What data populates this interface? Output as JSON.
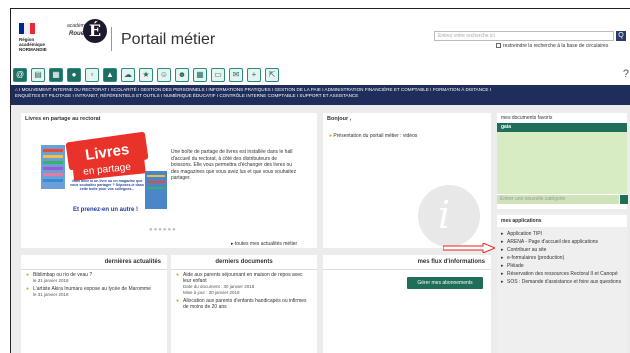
{
  "header": {
    "region": "Région académique NORMANDIE",
    "academy_small": "académie",
    "academy_name": "Rouen",
    "academy_letter": "É",
    "title": "Portail métier",
    "search_placeholder": "Entrez votre recherche ici",
    "search_button": "Q",
    "restrict_label": "restreindre la recherche à la base de circulaires"
  },
  "iconbar": {
    "icons": [
      "at-icon",
      "form-icon",
      "table-icon",
      "person-icon",
      "book-icon",
      "building-icon",
      "cloud-icon",
      "org-icon",
      "people-icon",
      "group-icon",
      "grid-icon",
      "screen-icon",
      "mail-icon",
      "plus-icon",
      "share-icon"
    ],
    "right": "?"
  },
  "nav": {
    "line1": "⌂ I  MOUVEMENT INTERNE DU RECTORAT  I  SCOLARITÉ  I  GESTION DES PERSONNELS  I  INFORMATIONS PRATIQUES  I  GESTION DE LA PAIE  I  ADMINISTRATION FINANCIÈRE ET COMPTABLE  I  FORMATION À DISTANCE  I",
    "line2": "ENQUÊTES ET PILOTAGE  I  INTRANET, RÉFÉRENTIELS ET OUTILS  I  NUMÉRIQUE ÉDUCATIF  I  CONTRÔLE INTERNE COMPTABLE  I  SUPPORT ET ASSISTANCE"
  },
  "news": {
    "heading": "Livres en partage au rectorat",
    "poster_title_1": "Livres",
    "poster_title_2": "en partage",
    "poster_text": "Vous avez lu un livre ou un magazine que vous souhaitez partager ? Déposez-le dans cette boîte pour vos collègues...",
    "poster_cta": "Et prenez-en un autre !",
    "body": "Une boîte de partage de livres est installée dans le hall d'accueil du rectorat, à côté des distributeurs de boissons. Elle vous permettra d'échanger des livres ou des magazines que vous avez lus et que vous souhaitez partager.",
    "dots": "●●●●●●",
    "more_link": "▸ toutes mes actualités métier"
  },
  "bonjour": {
    "heading": "Bonjour ,",
    "item": "Présentation du portail métier : vidéos",
    "info_glyph": "i"
  },
  "favorites": {
    "heading": "mes documents favoris",
    "bar": "gaia",
    "category_placeholder": "Entrer une nouvelle catégorie"
  },
  "apps": {
    "heading": "mes applications",
    "items": [
      "Application TIPI",
      "ARENA - Page d'accueil des applications",
      "Contribuer au site",
      "e-formulaires (production)",
      "Pléiade",
      "Réservation des ressources Rectoral II et Canopé",
      "SOS : Demande d'assistance et foire aux questions"
    ]
  },
  "actualites": {
    "heading": "dernières actualités",
    "items": [
      {
        "title": "Biblimbap ou rio de veau ?",
        "date": "le 31 janvier 2018"
      },
      {
        "title": "L'artiste Akira Inumaru expose au lycée de Maromme",
        "date": "le 31 janvier 2018"
      }
    ]
  },
  "documents": {
    "heading": "derniers documents",
    "items": [
      {
        "title": "Aide aux parents séjournant en maison de repos avec leur enfant",
        "date1": "Date du document : 30 janvier 2018",
        "date2": "Mise à jour : 30 janvier 2018"
      },
      {
        "title": "Allocation aux parents d'enfants handicapés ou infirmes de moins de 20 ans",
        "date1": "",
        "date2": ""
      }
    ]
  },
  "flux": {
    "heading": "mes flux d'informations",
    "button": "Gérer mes abonnements"
  },
  "colors": {
    "nav": "#1e2d5a",
    "teal": "#1e6e5a",
    "fav_bg": "#d7ecc3",
    "bullet": "#e8a020"
  }
}
